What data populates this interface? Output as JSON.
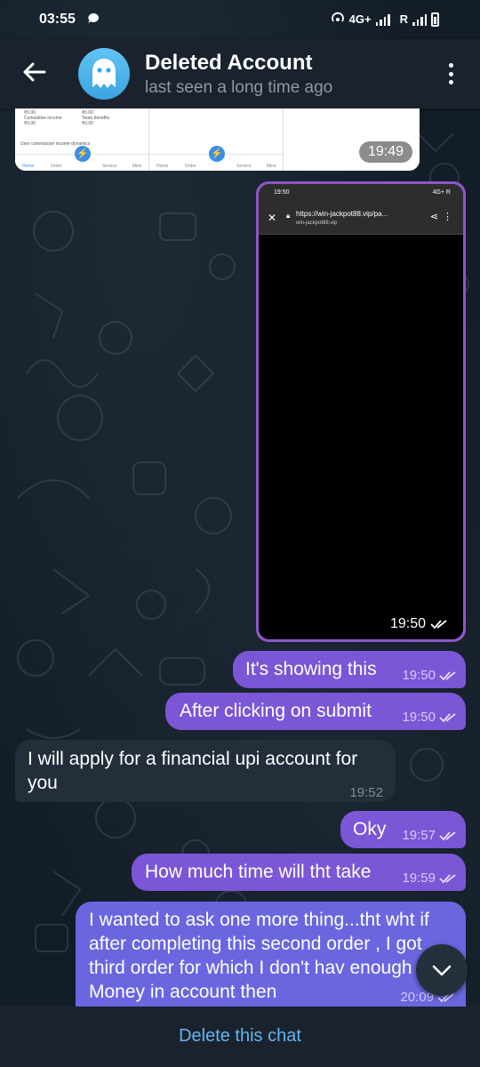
{
  "status_bar": {
    "time": "03:55",
    "network": "4G+",
    "roaming": "R"
  },
  "header": {
    "title": "Deleted Account",
    "subtitle": "last seen a long time ago"
  },
  "screenshot_1": {
    "time": "19:49",
    "labels": {
      "cumulative_income": "Cumulative income",
      "team_benefits": "Team benefits",
      "amount_1": "₹0.00",
      "amount_2": "₹0.00",
      "amount_3": "₹0.00",
      "amount_4": "₹0.00",
      "commission": "User commission income dynamics"
    },
    "nav": [
      "Home",
      "Order",
      "Service",
      "Mine",
      "Home",
      "Order",
      "Service",
      "Mine"
    ]
  },
  "screenshot_2": {
    "status_time": "19:50",
    "status_right": "4G+ R",
    "url": "https://win-jackpot88.vip/pa...",
    "domain": "win-jackpot88.vip",
    "time": "19:50"
  },
  "messages": [
    {
      "text": "It's showing this",
      "time": "19:50",
      "outgoing": true
    },
    {
      "text": "After clicking on submit",
      "time": "19:50",
      "outgoing": true
    },
    {
      "text": "I will apply for a financial upi account for you",
      "time": "19:52",
      "outgoing": false
    },
    {
      "text": "Oky",
      "time": "19:57",
      "outgoing": true
    },
    {
      "text": "How much time will tht take",
      "time": "19:59",
      "outgoing": true
    },
    {
      "text": "I wanted to ask one more thing...tht wht if after completing this second order , I got third order for which I don't hav enough Money in account then",
      "time": "20:09",
      "outgoing": true
    }
  ],
  "footer": {
    "action": "Delete this chat"
  },
  "colors": {
    "outgoing_bubble": "#7b56d7",
    "incoming_bubble": "#222e3a",
    "accent": "#64b5ef"
  }
}
